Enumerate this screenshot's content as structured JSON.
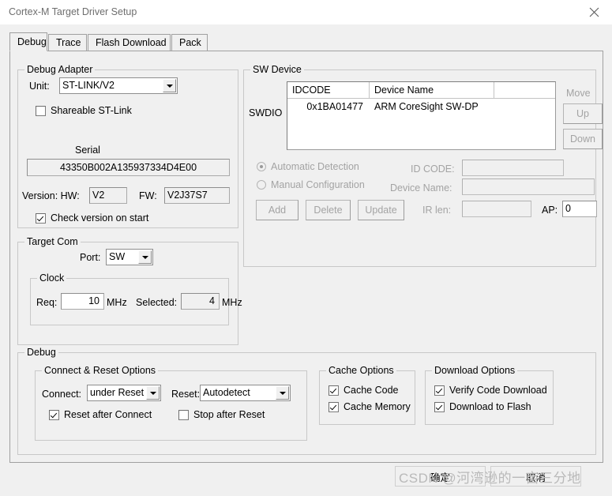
{
  "window": {
    "title": "Cortex-M Target Driver Setup",
    "close_icon": "close-icon"
  },
  "tabs": [
    {
      "label": "Debug",
      "active": true
    },
    {
      "label": "Trace",
      "active": false
    },
    {
      "label": "Flash Download",
      "active": false
    },
    {
      "label": "Pack",
      "active": false
    }
  ],
  "debug_adapter": {
    "group_label": "Debug Adapter",
    "unit_label": "Unit:",
    "unit_value": "ST-LINK/V2",
    "shareable_label": "Shareable ST-Link",
    "shareable_checked": false,
    "serial_label": "Serial",
    "serial_value": "43350B002A135937334D4E00",
    "version_label": "Version: HW:",
    "hw_value": "V2",
    "fw_label": "FW:",
    "fw_value": "V2J37S7",
    "check_version_label": "Check version on start",
    "check_version_checked": true
  },
  "target_com": {
    "group_label": "Target Com",
    "port_label": "Port:",
    "port_value": "SW",
    "clock_label": "Clock",
    "req_label": "Req:",
    "req_value": "10",
    "req_unit": "MHz",
    "selected_label": "Selected:",
    "selected_value": "4",
    "selected_unit": "MHz"
  },
  "sw_device": {
    "group_label": "SW Device",
    "swdio_label": "SWDIO",
    "columns": [
      "IDCODE",
      "Device Name",
      ""
    ],
    "rows": [
      {
        "idcode": "0x1BA01477",
        "device_name": "ARM CoreSight SW-DP",
        "extra": ""
      }
    ],
    "move_label": "Move",
    "up_label": "Up",
    "down_label": "Down",
    "automatic_detection_label": "Automatic Detection",
    "automatic_detection_selected": true,
    "manual_configuration_label": "Manual Configuration",
    "manual_configuration_selected": false,
    "id_code_label": "ID CODE:",
    "id_code_value": "",
    "device_name_label": "Device Name:",
    "device_name_value": "",
    "add_label": "Add",
    "delete_label": "Delete",
    "update_label": "Update",
    "ir_len_label": "IR len:",
    "ir_len_value": "",
    "ap_label": "AP:",
    "ap_value": "0"
  },
  "debug_section": {
    "group_label": "Debug",
    "connect_reset": {
      "group_label": "Connect & Reset Options",
      "connect_label": "Connect:",
      "connect_value": "under Reset",
      "reset_label": "Reset:",
      "reset_value": "Autodetect",
      "reset_after_connect_label": "Reset after Connect",
      "reset_after_connect_checked": true,
      "stop_after_reset_label": "Stop after Reset",
      "stop_after_reset_checked": false
    },
    "cache_options": {
      "group_label": "Cache Options",
      "cache_code_label": "Cache Code",
      "cache_code_checked": true,
      "cache_memory_label": "Cache Memory",
      "cache_memory_checked": true
    },
    "download_options": {
      "group_label": "Download Options",
      "verify_code_download_label": "Verify Code Download",
      "verify_code_download_checked": true,
      "download_to_flash_label": "Download to Flash",
      "download_to_flash_checked": true
    }
  },
  "dialog_buttons": {
    "ok_label": "确定",
    "cancel_label": "取消"
  },
  "watermark": {
    "text": "CSDN @河湾逊的一亩三分地"
  },
  "colors": {
    "window_bg": "#f0f0f0",
    "titlebar_bg": "#ffffff",
    "field_bg": "#ffffff",
    "border": "#a0a0a0",
    "disabled_text": "#a3a3a3",
    "watermark": "#b9b9b9"
  }
}
